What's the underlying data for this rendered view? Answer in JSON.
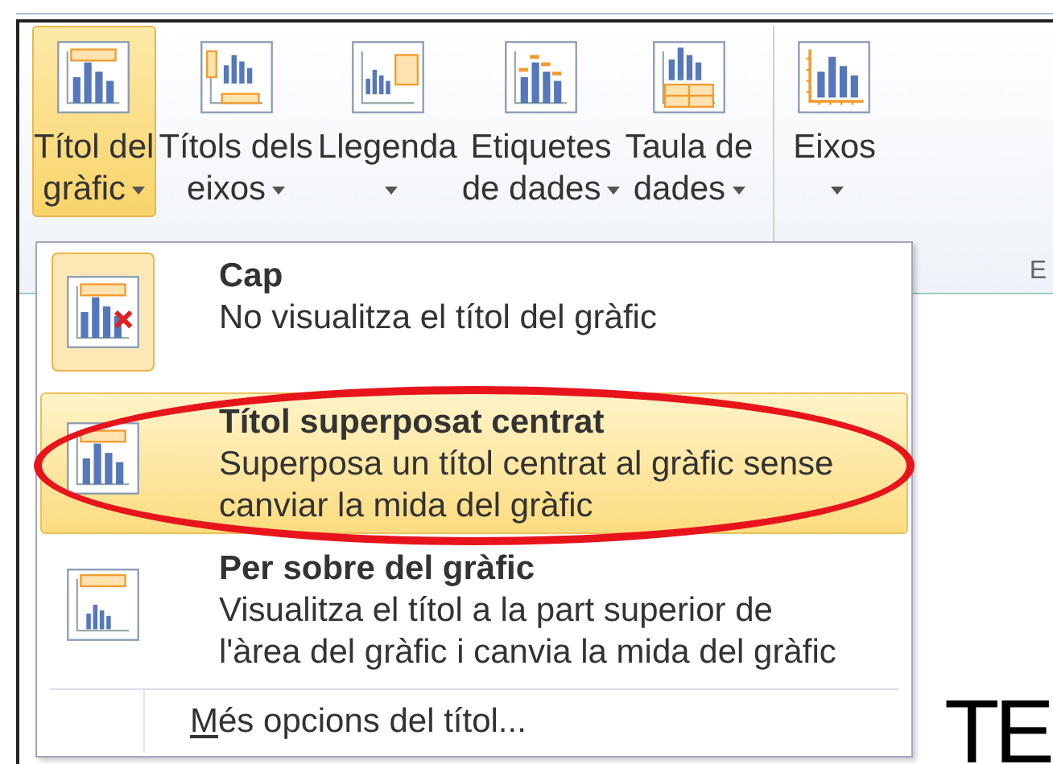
{
  "ribbon": {
    "groups": [
      [
        {
          "kind": "title",
          "lines": [
            "Títol del",
            "gràfic"
          ],
          "selected": true
        },
        {
          "kind": "axis-titles",
          "lines": [
            "Títols dels",
            "eixos"
          ],
          "selected": false
        },
        {
          "kind": "legend",
          "lines": [
            "Llegenda"
          ],
          "selected": false
        },
        {
          "kind": "data-labels",
          "lines": [
            "Etiquetes",
            "de dades"
          ],
          "selected": false
        },
        {
          "kind": "data-table",
          "lines": [
            "Taula de",
            "dades"
          ],
          "selected": false
        }
      ],
      [
        {
          "kind": "axes",
          "lines": [
            "Eixos"
          ],
          "selected": false
        }
      ]
    ],
    "group_label": "E"
  },
  "sheet_text": "TE",
  "menu": {
    "items": [
      {
        "kind": "none",
        "title": "Cap",
        "description": "No visualitza el títol del gràfic",
        "selected": true,
        "hovered": false,
        "circled": false
      },
      {
        "kind": "overlay",
        "title": "Títol superposat centrat",
        "description": "Superposa un títol centrat al gràfic sense canviar la mida del gràfic",
        "selected": false,
        "hovered": true,
        "circled": true
      },
      {
        "kind": "above",
        "title": "Per sobre del gràfic",
        "description": "Visualitza el títol a la part superior de l'àrea del gràfic i canvia la mida del gràfic",
        "selected": false,
        "hovered": false,
        "circled": false
      }
    ],
    "footer": "Més opcions del títol..."
  }
}
